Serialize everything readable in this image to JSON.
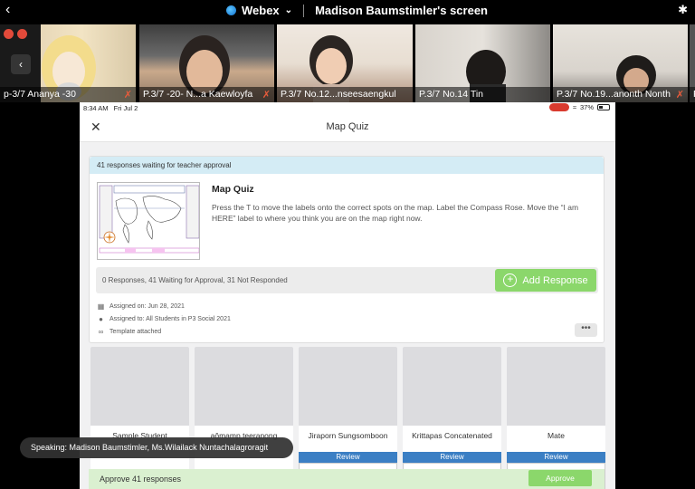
{
  "webex": {
    "app_name": "Webex",
    "screen_title": "Madison Baumstimler's screen"
  },
  "participants": [
    {
      "name": "p-3/7 Ananya -30"
    },
    {
      "name": "P.3/7 -20- N...a Kaewloyfa"
    },
    {
      "name": "P.3/7 No.12...nseesaengkul"
    },
    {
      "name": "P.3/7 No.14 Tin"
    },
    {
      "name": "P.3/7 No.19...anonth Nonth"
    },
    {
      "name": "P"
    }
  ],
  "ipad": {
    "time": "8:34 AM",
    "date": "Fri Jul 2",
    "battery": "37%"
  },
  "nav": {
    "title": "Map Quiz"
  },
  "assignment": {
    "banner": "41 responses waiting for teacher approval",
    "title": "Map Quiz",
    "description": "Press the T to move the labels onto the correct spots on the map. Label the Compass Rose. Move the “I am HERE” label to where you think you are on the map right now.",
    "responses_summary": "0 Responses, 41 Waiting for Approval, 31 Not Responded",
    "add_response_label": "Add Response",
    "assigned_on": "Assigned on: Jun 28, 2021",
    "assigned_to": "Assigned to: All Students in P3 Social 2021",
    "template": "Template attached"
  },
  "responses": [
    {
      "name": "Sample Student",
      "review": ""
    },
    {
      "name": "aômamp teeranong",
      "review": ""
    },
    {
      "name": "Jiraporn Sungsomboon",
      "review": "Review"
    },
    {
      "name": "Krittapas Concatenated",
      "review": "Review"
    },
    {
      "name": "Mate",
      "review": "Review"
    }
  ],
  "approve": {
    "text": "Approve 41 responses",
    "button": "Approve"
  },
  "speaking": "Speaking: Madison Baumstimler, Ms.Wilailack Nuntachalagroragit",
  "colors": {
    "accent_green": "#8bd76b",
    "banner_blue": "#d4ecf5",
    "review_blue": "#3b7fc4",
    "recording_red": "#e24a3a"
  }
}
